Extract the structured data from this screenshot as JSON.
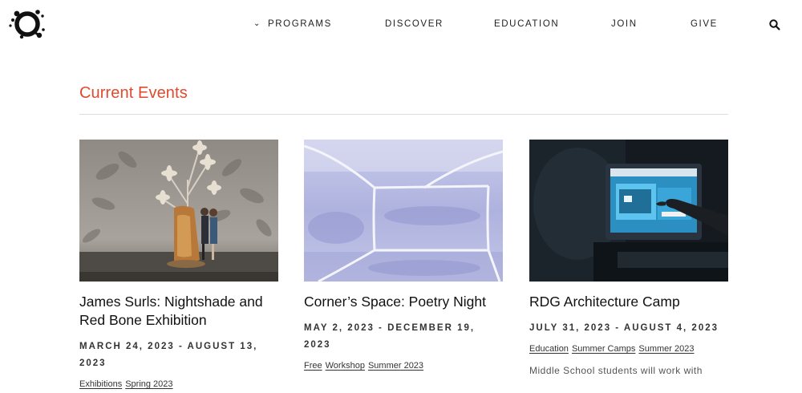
{
  "nav": {
    "programs": "PROGRAMS",
    "discover": "DISCOVER",
    "education": "EDUCATION",
    "join": "JOIN",
    "give": "GIVE"
  },
  "icons": {
    "logo": "splash-logo-icon",
    "programs_chevron": "chevron-down-icon",
    "search": "search-icon"
  },
  "colors": {
    "accent": "#e04a2e",
    "text": "#111111"
  },
  "section": {
    "title": "Current Events"
  },
  "events": [
    {
      "title_line1": "James Surls: Nightshade and",
      "title_line2": "Red Bone Exhibition",
      "date_line1": "MARCH 24, 2023 - AUGUST 13,",
      "date_line2": "2023",
      "tags": [
        "Exhibitions",
        "Spring 2023"
      ],
      "description": ""
    },
    {
      "title_line1": "Corner’s Space: Poetry Night",
      "title_line2": "",
      "date_line1": "MAY 2, 2023 - DECEMBER 19,",
      "date_line2": "2023",
      "tags": [
        "Free",
        "Workshop",
        "Summer 2023"
      ],
      "description": ""
    },
    {
      "title_line1": "RDG Architecture Camp",
      "title_line2": "",
      "date_line1": "JULY 31, 2023 - AUGUST 4, 2023",
      "date_line2": "",
      "tags": [
        "Education",
        "Summer Camps",
        "Summer 2023"
      ],
      "description": "Middle School students will work with"
    }
  ]
}
